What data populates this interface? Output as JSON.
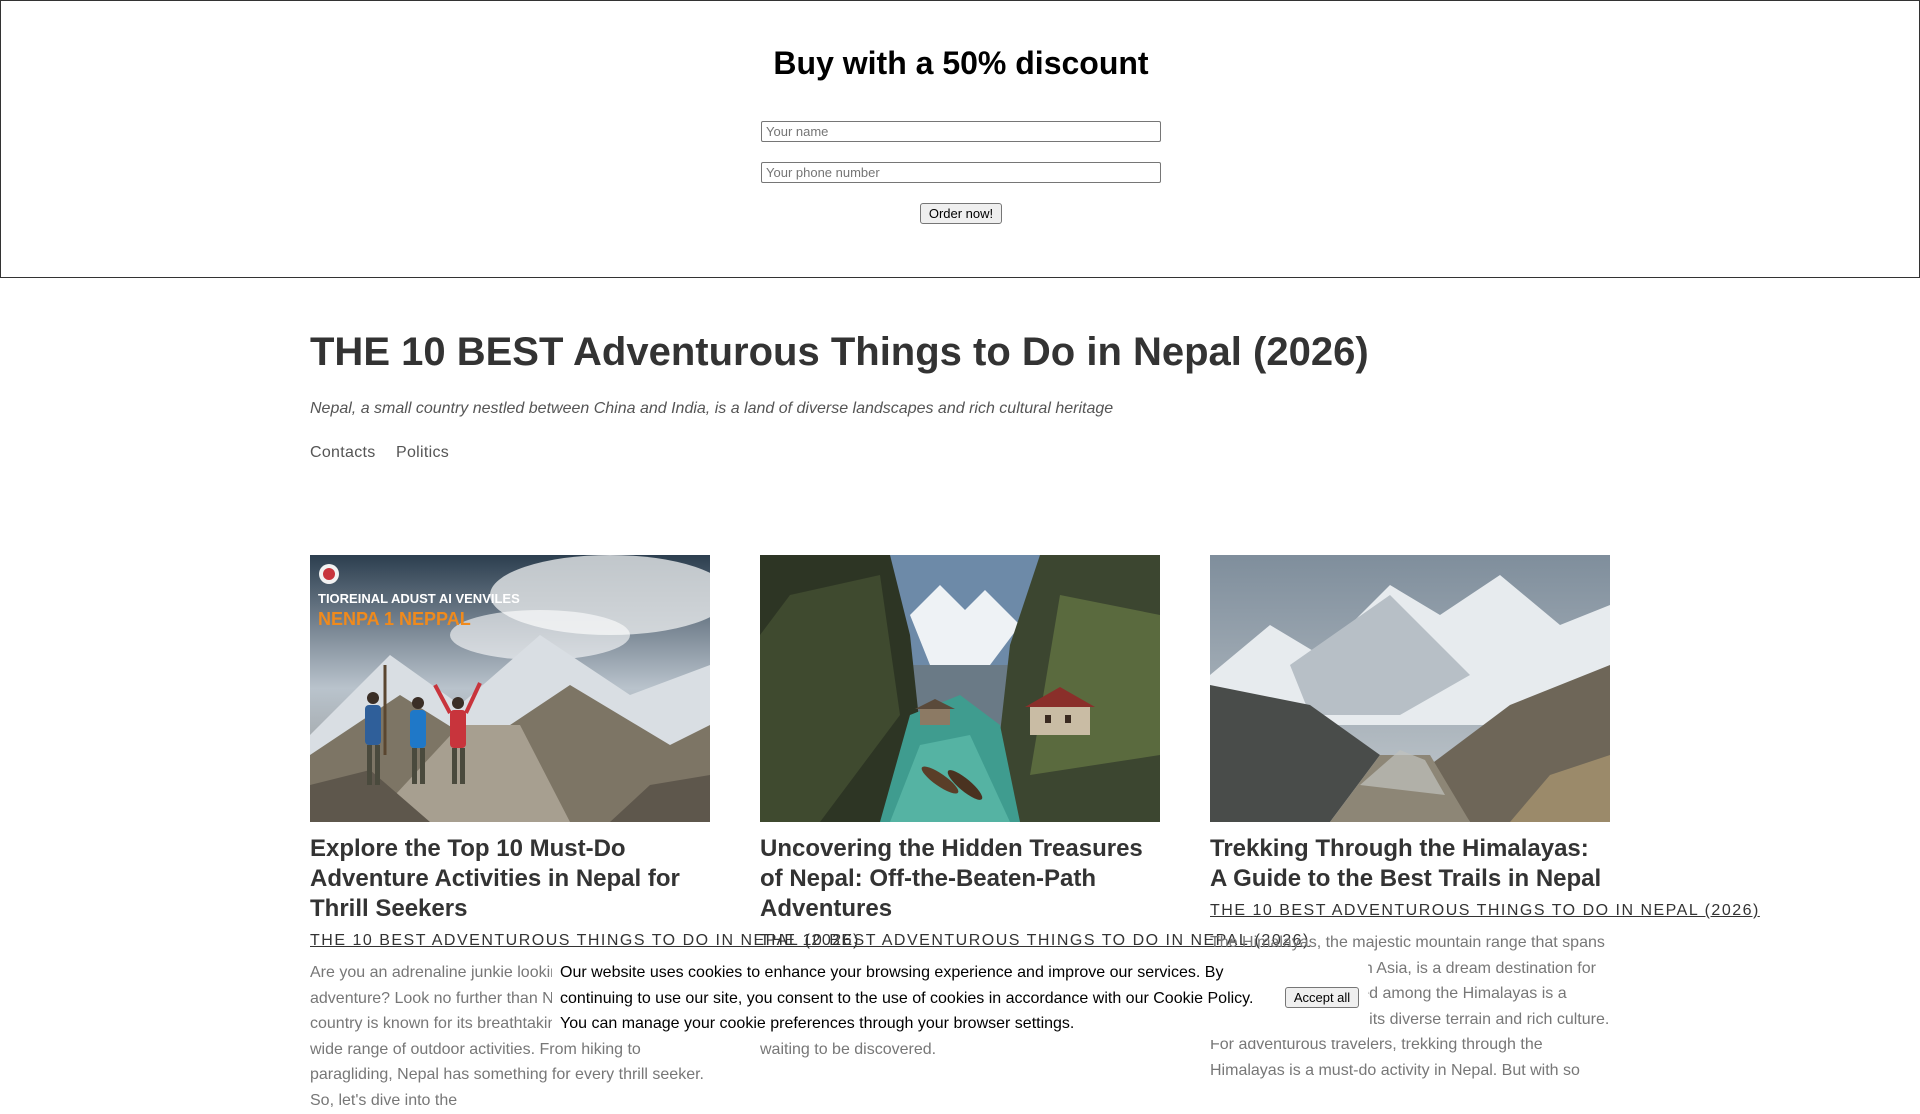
{
  "promo": {
    "title": "Buy with a 50% discount",
    "name_placeholder": "Your name",
    "phone_placeholder": "Your phone number",
    "order_label": "Order now!"
  },
  "site": {
    "title": "THE 10 BEST Adventurous Things to Do in Nepal (2026)",
    "tagline": "Nepal, a small country nestled between China and India, is a land of diverse landscapes and rich cultural heritage",
    "nav": [
      "Contacts",
      "Politics"
    ]
  },
  "cards": [
    {
      "image": "trekkers-mountain-trail-photo",
      "image_text_line1": "TIOREINAL ADUST AI VENVILES",
      "image_text_line2": "NENPA 1 NEPPAL",
      "title": "Explore the Top 10 Must-Do Adventure Activities in Nepal for Thrill Seekers",
      "category": "THE 10 BEST ADVENTUROUS THINGS TO DO IN NEPAL (2026)",
      "excerpt": "Are you an adrenaline junkie looking for your next big adventure? Look no further than Nepal! This stunning country is known for its breathtaking landscapes and a wide range of outdoor activities. From hiking to paragliding, Nepal has something for every thrill seeker. So, let's dive into the"
    },
    {
      "image": "river-valley-village-photo",
      "title": "Uncovering the Hidden Treasures of Nepal: Off-the-Beaten-Path Adventures",
      "category": "THE 10 BEST ADVENTUROUS THINGS TO DO IN NEPAL (2026)",
      "excerpt": "Nepal is a country of breathtaking beauty and rich culture. Beyond the well-traveled paths of Everest Base Camp and Kathmandu lies a world of hidden gems waiting to be discovered."
    },
    {
      "image": "himalaya-valley-photo",
      "title": "Trekking Through the Himalayas: A Guide to the Best Trails in Nepal",
      "category": "THE 10 BEST ADVENTUROUS THINGS TO DO IN NEPAL (2026)",
      "excerpt": "The Himalayas, the majestic mountain range that spans across five countries in Asia, is a dream destination for trekkers. Nepal, nestled among the Himalayas is a paradise for hikers for its diverse terrain and rich culture. For adventurous travelers, trekking through the Himalayas is a must-do activity in Nepal. But with so"
    }
  ],
  "cookie": {
    "text": "Our website uses cookies to enhance your browsing experience and improve our services. By continuing to use our site, you consent to the use of cookies in accordance with our Cookie Policy. You can manage your cookie preferences through your browser settings.",
    "accept_label": "Accept all"
  }
}
